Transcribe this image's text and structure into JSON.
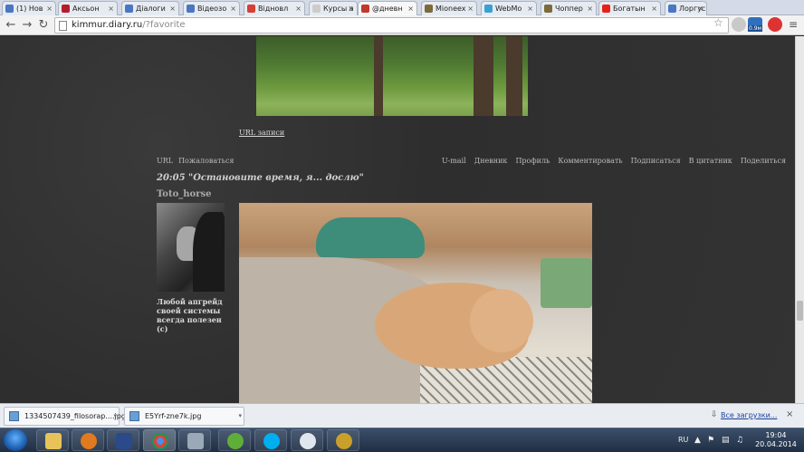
{
  "tabs": [
    {
      "label": "(1) Нов",
      "color": "#4a76c2"
    },
    {
      "label": "Аксьон",
      "color": "#b41e2a"
    },
    {
      "label": "Діалоги",
      "color": "#4a76c2"
    },
    {
      "label": "Відеозо",
      "color": "#4a76c2"
    },
    {
      "label": "Відновл",
      "color": "#d44033"
    },
    {
      "label": "Курсы а",
      "color": "#cccccc"
    },
    {
      "label": "@дневн",
      "color": "#c0392b"
    },
    {
      "label": "Mioneex",
      "color": "#7c6a3a"
    },
    {
      "label": "WebMo",
      "color": "#3aa0d4"
    },
    {
      "label": "Чоппер",
      "color": "#7c6a3a"
    },
    {
      "label": "Богатын",
      "color": "#e62117"
    },
    {
      "label": "Лоргус",
      "color": "#4a76c2"
    }
  ],
  "toolbar": {
    "url_host": "kimmur.diary.ru",
    "url_path": "/?favorite",
    "badge": "0.9м"
  },
  "post": {
    "url_link": "URL записи",
    "meta_left": [
      "URL",
      "Пожаловаться"
    ],
    "meta_right": [
      "U-mail",
      "Дневник",
      "Профиль",
      "Комментировать",
      "Подписаться",
      "В цитатник",
      "Поделиться"
    ],
    "title": "20:05 \"Остановите время, я... дослю\"",
    "author": "Toto_horse",
    "user_caption": "Любой апгрейд своей системы всегда полезен (с)"
  },
  "downloads": {
    "items": [
      "1334507439_filosorap....jpg",
      "E5Yrf-zne7k.jpg"
    ],
    "all_label": "Все загрузки..."
  },
  "taskbar": {
    "lang": "RU",
    "time": "19:04",
    "date": "20.04.2014"
  }
}
